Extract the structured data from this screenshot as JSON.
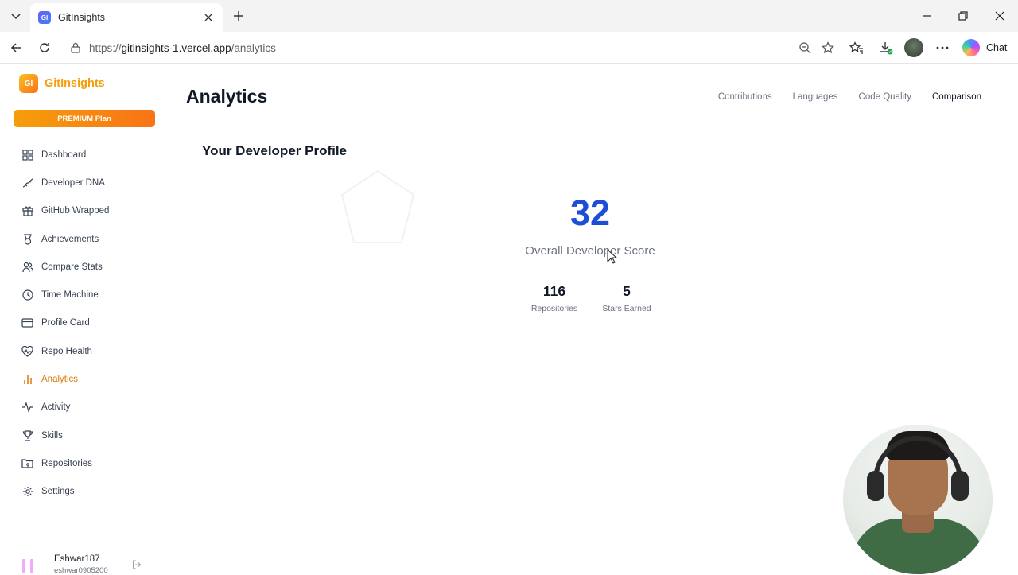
{
  "browser": {
    "tab_title": "GitInsights",
    "tab_favicon_text": "GI",
    "url_scheme": "https://",
    "url_host": "gitinsights-1.vercel.app",
    "url_path": "/analytics",
    "chat_label": "Chat"
  },
  "sidebar": {
    "brand_logo_text": "GI",
    "brand_name": "GitInsights",
    "plan_label": "PREMIUM Plan",
    "items": [
      {
        "label": "Dashboard",
        "icon": "grid-icon"
      },
      {
        "label": "Developer DNA",
        "icon": "dna-icon"
      },
      {
        "label": "GitHub Wrapped",
        "icon": "gift-icon"
      },
      {
        "label": "Achievements",
        "icon": "medal-icon"
      },
      {
        "label": "Compare Stats",
        "icon": "users-icon"
      },
      {
        "label": "Time Machine",
        "icon": "clock-icon"
      },
      {
        "label": "Profile Card",
        "icon": "card-icon"
      },
      {
        "label": "Repo Health",
        "icon": "heart-pulse-icon"
      },
      {
        "label": "Analytics",
        "icon": "bar-chart-icon"
      },
      {
        "label": "Activity",
        "icon": "activity-icon"
      },
      {
        "label": "Skills",
        "icon": "trophy-icon"
      },
      {
        "label": "Repositories",
        "icon": "folder-git-icon"
      },
      {
        "label": "Settings",
        "icon": "gear-icon"
      }
    ],
    "active_item": "Analytics",
    "user": {
      "name": "Eshwar187",
      "email": "eshwar0905200"
    }
  },
  "main": {
    "title": "Analytics",
    "tabs": [
      "Contributions",
      "Languages",
      "Code Quality",
      "Comparison"
    ],
    "active_tab": "Comparison",
    "section_title": "Your Developer Profile",
    "score": "32",
    "score_label": "Overall Developer Score",
    "stats": [
      {
        "value": "116",
        "label": "Repositories"
      },
      {
        "value": "5",
        "label": "Stars Earned"
      }
    ]
  },
  "colors": {
    "accent": "#f59e0b",
    "score": "#1d4ed8",
    "active_nav": "#d97706"
  }
}
